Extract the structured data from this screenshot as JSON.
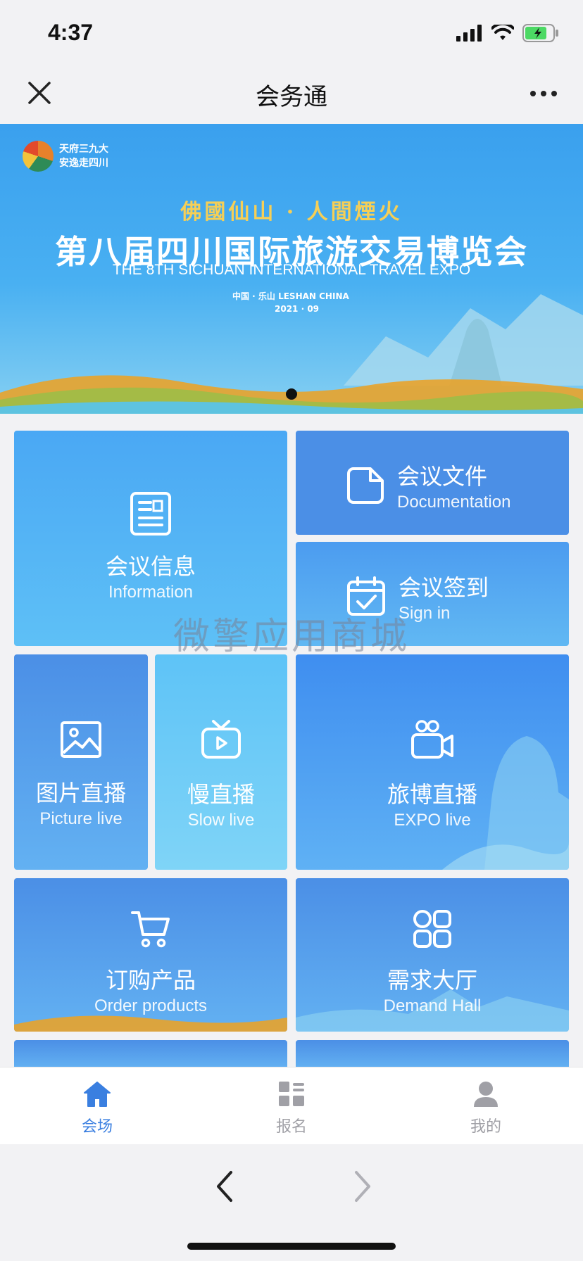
{
  "status_bar": {
    "time": "4:37"
  },
  "nav": {
    "title": "会务通"
  },
  "banner": {
    "logo_line1": "天府三九大",
    "logo_line2": "安逸走四川",
    "slogan": "佛國仙山 · 人間煙火",
    "title": "第八届四川国际旅游交易博览会",
    "subtitle": "THE 8TH SICHUAN INTERNATIONAL TRAVEL EXPO",
    "location": "中国 · 乐山    LESHAN CHINA",
    "date": "2021 · 09",
    "slide_count": 1,
    "active_slide": 1
  },
  "tiles": {
    "information": {
      "zh": "会议信息",
      "en": "Information",
      "icon": "document-icon"
    },
    "documentation": {
      "zh": "会议文件",
      "en": "Documentation",
      "icon": "file-icon"
    },
    "sign_in": {
      "zh": "会议签到",
      "en": "Sign in",
      "icon": "calendar-check-icon"
    },
    "picture_live": {
      "zh": "图片直播",
      "en": "Picture live",
      "icon": "image-icon"
    },
    "slow_live": {
      "zh": "慢直播",
      "en": "Slow live",
      "icon": "tv-play-icon"
    },
    "expo_live": {
      "zh": "旅博直播",
      "en": "EXPO live",
      "icon": "video-camera-icon"
    },
    "order_products": {
      "zh": "订购产品",
      "en": "Order products",
      "icon": "cart-icon"
    },
    "demand_hall": {
      "zh": "需求大厅",
      "en": "Demand Hall",
      "icon": "grid-icon"
    }
  },
  "watermark": "微擎应用商城",
  "tab_bar": {
    "items": [
      {
        "label": "会场",
        "icon": "home-icon",
        "active": true
      },
      {
        "label": "报名",
        "icon": "dashboard-icon",
        "active": false
      },
      {
        "label": "我的",
        "icon": "user-icon",
        "active": false
      }
    ]
  },
  "colors": {
    "accent": "#3a7fe0",
    "tile_blue": "#4b8fe6",
    "tile_light": "#5ec3f7"
  }
}
